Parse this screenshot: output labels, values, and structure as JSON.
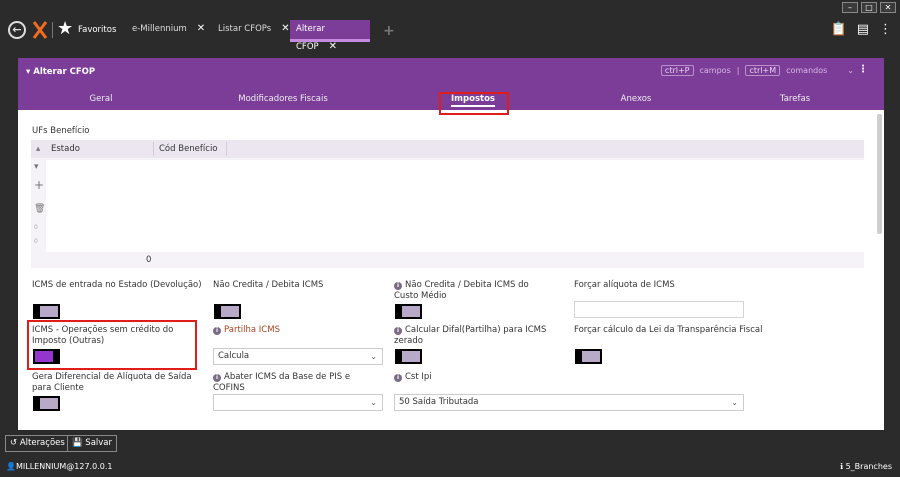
{
  "app": {
    "favorites_label": "Favoritos",
    "tabs": [
      {
        "label": "e-Millennium"
      },
      {
        "label": "Listar CFOPs"
      },
      {
        "label": "Alterar CFOP",
        "active": true
      }
    ]
  },
  "panel": {
    "title": "Alterar CFOP",
    "shortcut_fields_key": "ctrl+P",
    "shortcut_fields_label": "campos",
    "shortcut_separator": "|",
    "shortcut_commands_key": "ctrl+M",
    "shortcut_commands_label": "comandos",
    "subtabs": [
      "Geral",
      "Modificadores Fiscais",
      "Impostos",
      "Anexos",
      "Tarefas"
    ],
    "active_subtab": "Impostos"
  },
  "ufs": {
    "section_label": "UFs Benefício",
    "columns": [
      "Estado",
      "Cód Benefício"
    ],
    "count": "0",
    "toolbar_small_a": "0",
    "toolbar_small_b": "0"
  },
  "fields": {
    "icms_entrada": {
      "label": "ICMS de entrada no Estado (Devolução)",
      "on": false
    },
    "nao_credita": {
      "label": "Não Credita / Debita ICMS",
      "on": false
    },
    "nao_credita_custo": {
      "label": "Não Credita / Debita ICMS do Custo Médio",
      "on": false
    },
    "forcar_aliquota": {
      "label": "Forçar alíquota de ICMS",
      "value": ""
    },
    "icms_operacoes": {
      "label": "ICMS - Operações sem crédito do Imposto (Outras)",
      "on": true
    },
    "partilha_icms": {
      "label": "Partilha ICMS",
      "value": "Calcula"
    },
    "calcular_difal": {
      "label": "Calcular Difal(Partilha) para ICMS zerado",
      "on": false
    },
    "forcar_calculo_lei": {
      "label": "Forçar cálculo da Lei da Transparência Fiscal",
      "on": false
    },
    "gera_diferencial": {
      "label": "Gera Diferencial de Alíquota de Saída para Cliente",
      "on": false
    },
    "abater_icms": {
      "label": "Abater ICMS da Base de PIS e COFINS",
      "value": ""
    },
    "cst_ipi": {
      "label": "Cst Ipi",
      "value": "50 Saída Tributada"
    }
  },
  "bottom": {
    "alteracoes_label": "Alterações",
    "salvar_label": "Salvar",
    "user": "MILLENNIUM@127.0.0.1",
    "branch": "5_Branches"
  },
  "colors": {
    "accent": "#7b3d98",
    "toggle_on": "#9436ce",
    "highlight": "#e21b1b"
  }
}
